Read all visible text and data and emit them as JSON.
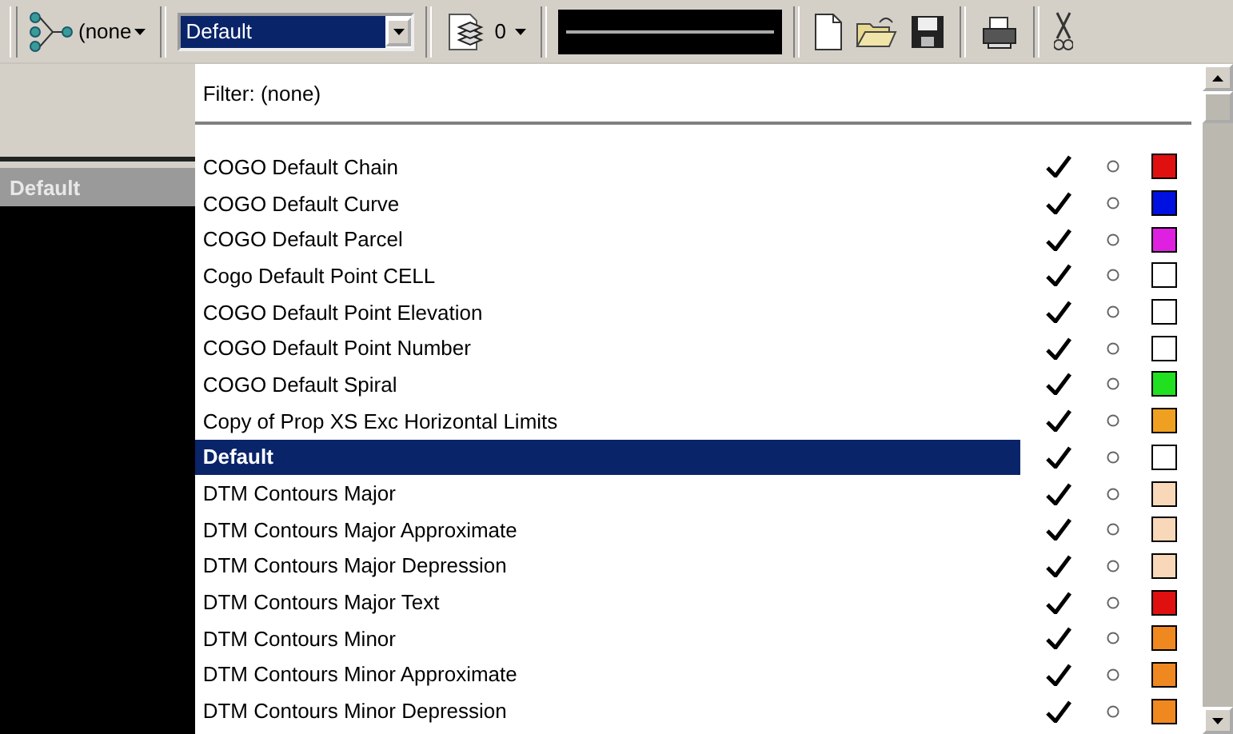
{
  "toolbar": {
    "style_selector": "(none",
    "style_combo": "Default",
    "level": "0"
  },
  "side_panel": {
    "label": "Default"
  },
  "dropdown": {
    "filter": "Filter: (none)",
    "items": [
      {
        "label": "COGO Default Chain",
        "checked": true,
        "selected": false,
        "color": "#e01010"
      },
      {
        "label": "COGO Default Curve",
        "checked": true,
        "selected": false,
        "color": "#0010e0"
      },
      {
        "label": "COGO Default Parcel",
        "checked": true,
        "selected": false,
        "color": "#e020e0"
      },
      {
        "label": "Cogo Default Point CELL",
        "checked": true,
        "selected": false,
        "color": "#ffffff"
      },
      {
        "label": "COGO Default Point Elevation",
        "checked": true,
        "selected": false,
        "color": "#ffffff"
      },
      {
        "label": "COGO Default Point Number",
        "checked": true,
        "selected": false,
        "color": "#ffffff"
      },
      {
        "label": "COGO Default Spiral",
        "checked": true,
        "selected": false,
        "color": "#20e020"
      },
      {
        "label": "Copy of Prop XS Exc Horizontal Limits",
        "checked": true,
        "selected": false,
        "color": "#f0a020"
      },
      {
        "label": "Default",
        "checked": true,
        "selected": true,
        "color": "#ffffff"
      },
      {
        "label": "DTM Contours Major",
        "checked": true,
        "selected": false,
        "color": "#f8d8b8"
      },
      {
        "label": "DTM Contours Major Approximate",
        "checked": true,
        "selected": false,
        "color": "#f8d8b8"
      },
      {
        "label": "DTM Contours Major Depression",
        "checked": true,
        "selected": false,
        "color": "#f8d8b8"
      },
      {
        "label": "DTM Contours Major Text",
        "checked": true,
        "selected": false,
        "color": "#e01010"
      },
      {
        "label": "DTM Contours Minor",
        "checked": true,
        "selected": false,
        "color": "#f08820"
      },
      {
        "label": "DTM Contours Minor Approximate",
        "checked": true,
        "selected": false,
        "color": "#f08820"
      },
      {
        "label": "DTM Contours Minor Depression",
        "checked": true,
        "selected": false,
        "color": "#f08820"
      }
    ]
  }
}
